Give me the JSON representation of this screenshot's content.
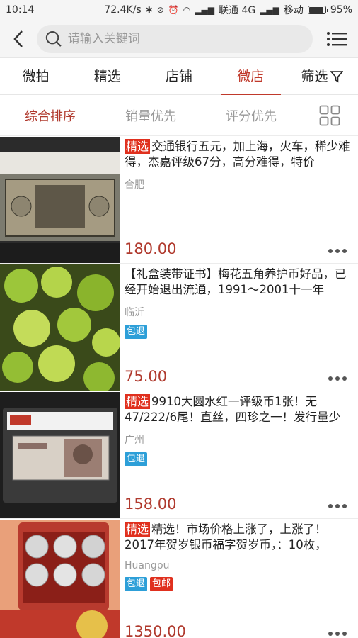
{
  "status_bar": {
    "time": "10:14",
    "net_speed": "72.4K/s",
    "carrier1": "联通 4G",
    "carrier2": "移动",
    "battery": "95%",
    "battery_level": 0.95
  },
  "search": {
    "placeholder": "请输入关键词"
  },
  "category_tabs": [
    {
      "label": "微拍"
    },
    {
      "label": "精选"
    },
    {
      "label": "店铺"
    },
    {
      "label": "微店"
    },
    {
      "label": "筛选"
    }
  ],
  "sort": {
    "options": [
      {
        "label": "综合排序"
      },
      {
        "label": "销量优先"
      },
      {
        "label": "评分优先"
      }
    ]
  },
  "products": [
    {
      "tag": "精选",
      "title": "交通银行五元，加上海，火车，稀少难得，杰嘉评级67分，高分难得，特价",
      "location": "合肥",
      "badges": [],
      "price": "180.00",
      "image": "graded-banknote-5-yuan"
    },
    {
      "tag": "",
      "title": "【礼盒装带证书】梅花五角养护币好品，已经开始退出流通，1991～2001十一年",
      "location": "临沂",
      "badges": [
        "包退"
      ],
      "price": "75.00",
      "image": "gold-coins-pile"
    },
    {
      "tag": "精选",
      "title": "9910大圆水红一评级币1张！无47/222/6尾！直丝，四珍之一！发行量少",
      "location": "广州",
      "badges": [
        "包退"
      ],
      "price": "158.00",
      "image": "graded-banknote-10-yuan"
    },
    {
      "tag": "精选",
      "title": "精选！市场价格上涨了，上涨了！2017年贺岁银币福字贺岁币，：10枚，",
      "location": "Huangpu",
      "badges": [
        "包退",
        "包邮"
      ],
      "price": "1350.00",
      "image": "silver-coins-box"
    }
  ]
}
